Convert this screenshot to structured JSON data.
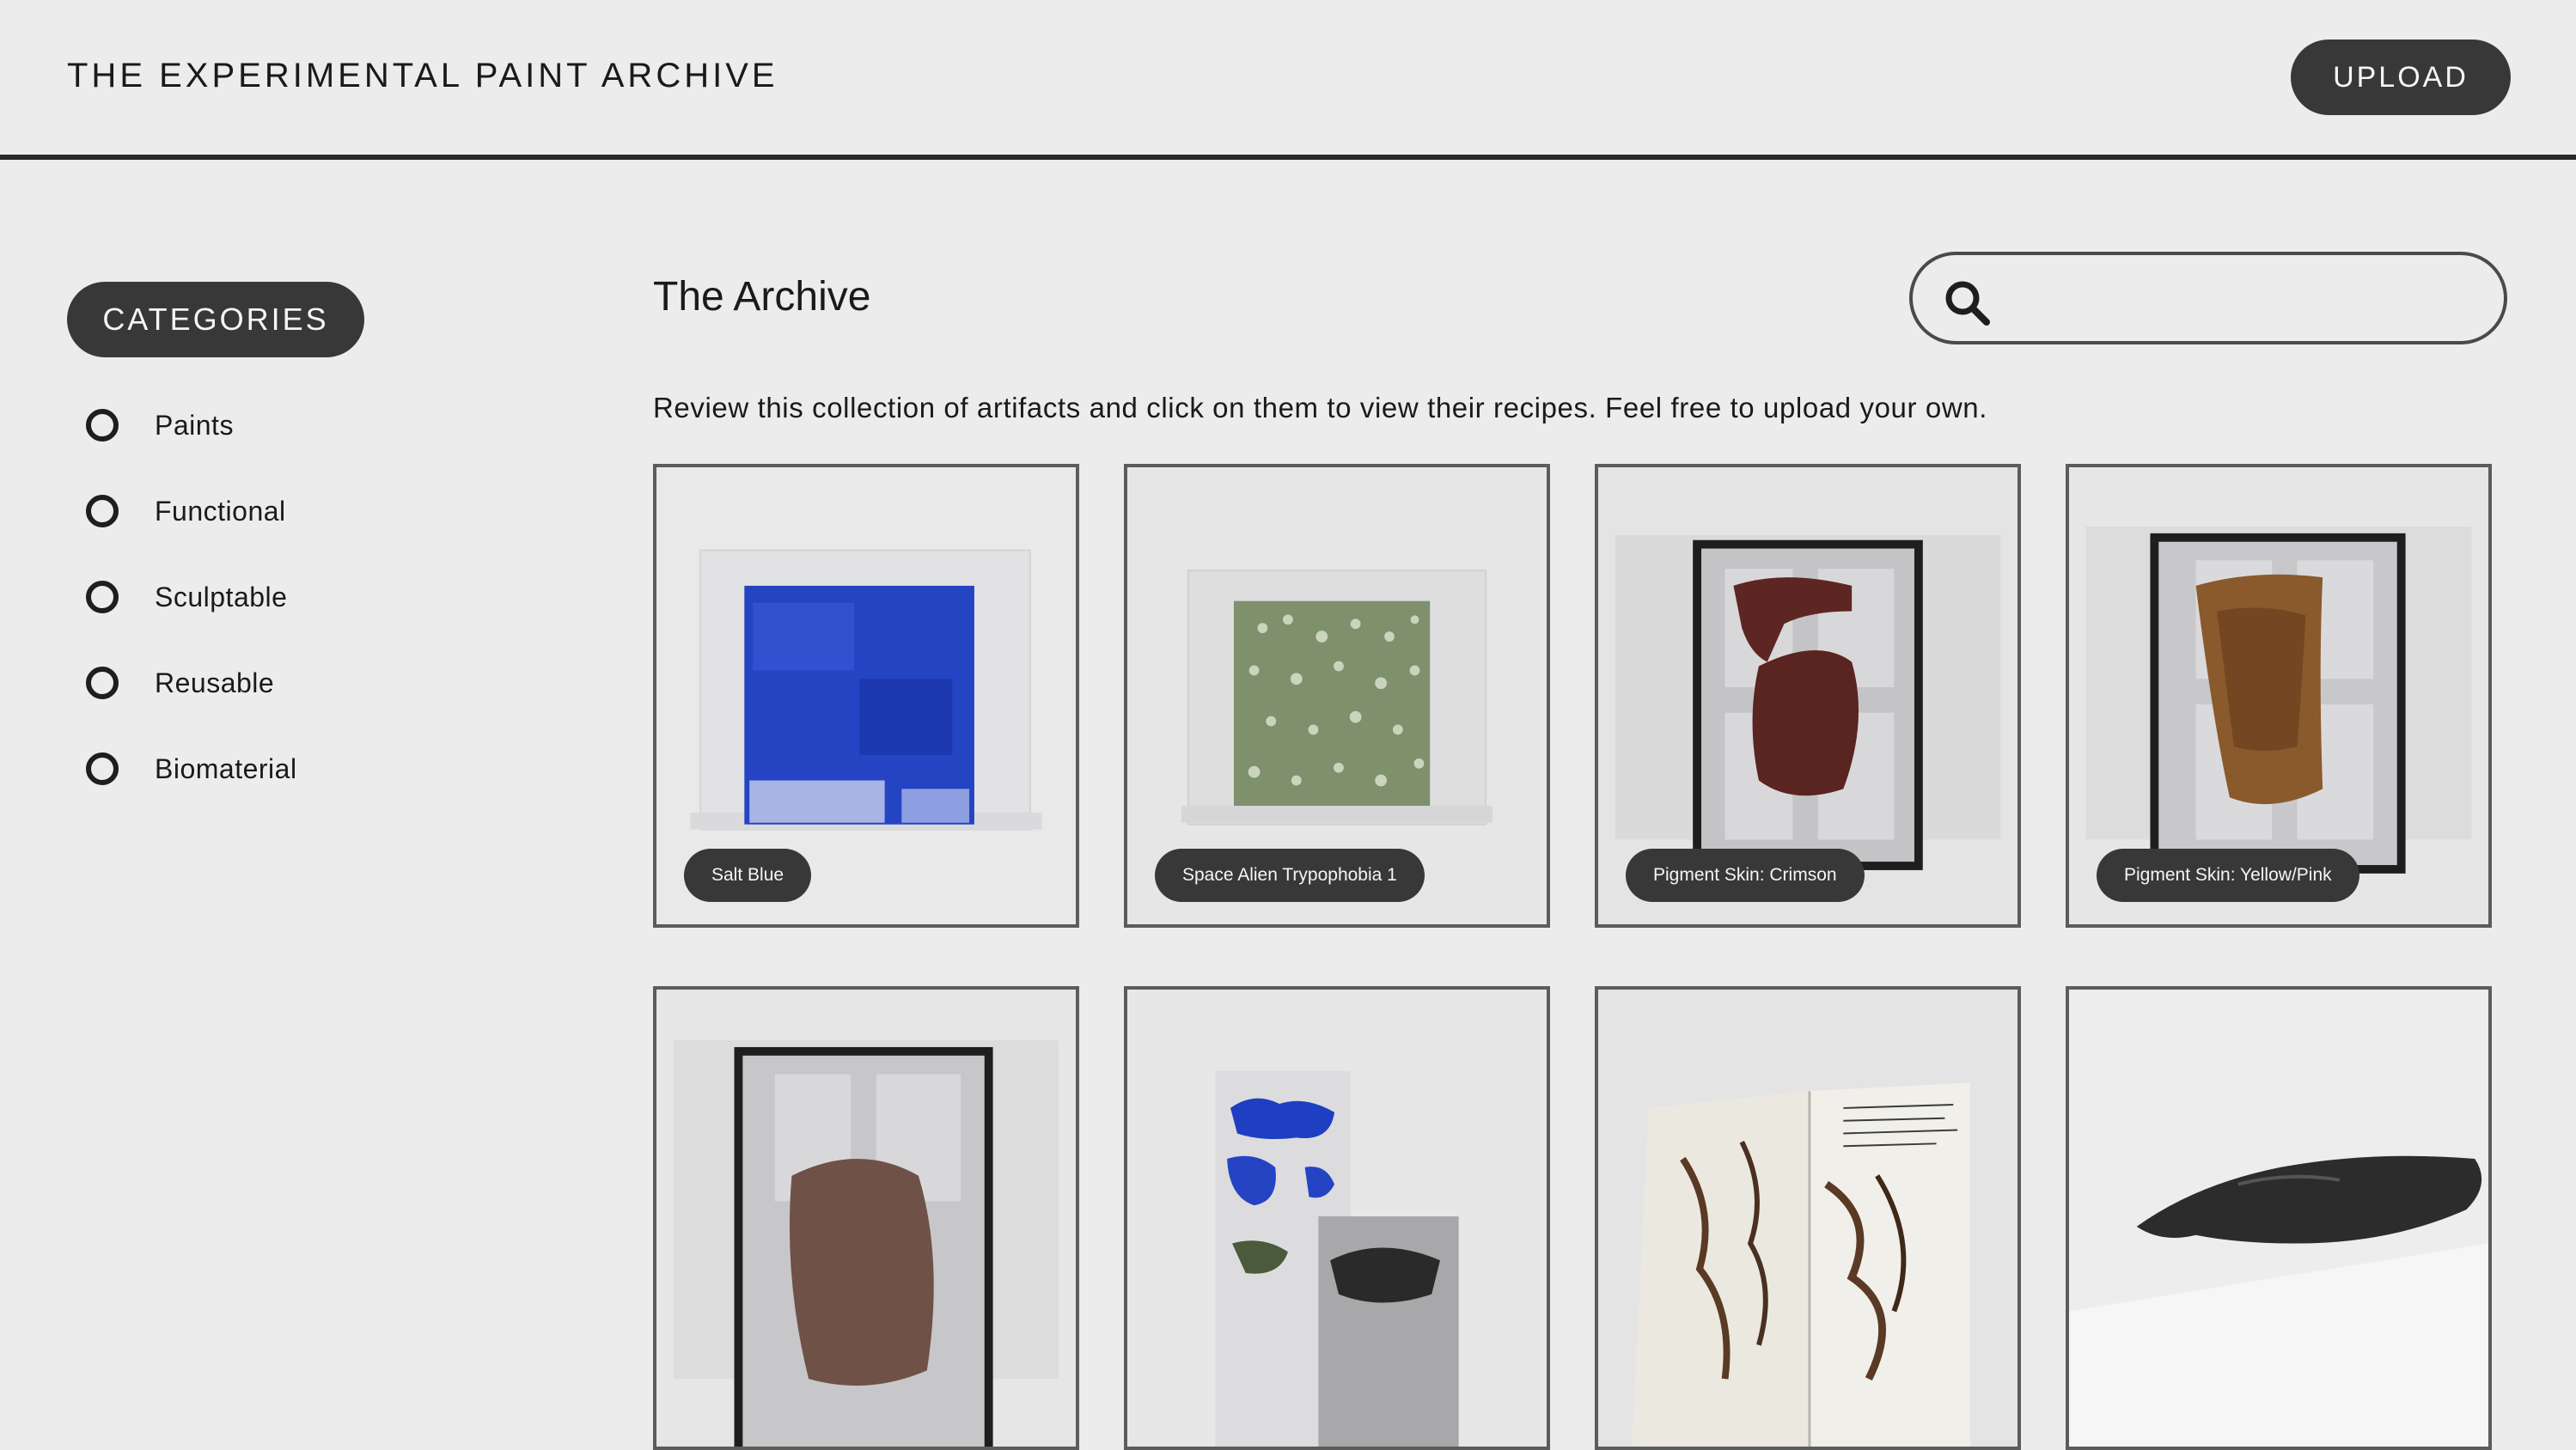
{
  "header": {
    "site_title": "THE EXPERIMENTAL PAINT ARCHIVE",
    "upload_label": "UPLOAD"
  },
  "sidebar": {
    "categories_label": "CATEGORIES",
    "items": [
      {
        "label": "Paints"
      },
      {
        "label": "Functional"
      },
      {
        "label": "Sculptable"
      },
      {
        "label": "Reusable"
      },
      {
        "label": "Biomaterial"
      }
    ]
  },
  "main": {
    "title": "The Archive",
    "intro": "Review this collection of artifacts and click on them to view their recipes. Feel free to upload your own.",
    "search": {
      "placeholder": "",
      "value": ""
    },
    "cards": [
      {
        "label": "Salt Blue"
      },
      {
        "label": "Space Alien Trypophobia 1"
      },
      {
        "label": "Pigment Skin: Crimson"
      },
      {
        "label": "Pigment Skin: Yellow/Pink"
      },
      {
        "label": ""
      },
      {
        "label": ""
      },
      {
        "label": ""
      },
      {
        "label": ""
      }
    ]
  },
  "colors": {
    "background": "#ececec",
    "pill": "#383838",
    "salt_blue": "#1f3fc2",
    "alien_green": "#7d8f6c",
    "crimson": "#5e2622",
    "yellow_pink": "#8a5a2c",
    "mauve": "#6f5148"
  }
}
